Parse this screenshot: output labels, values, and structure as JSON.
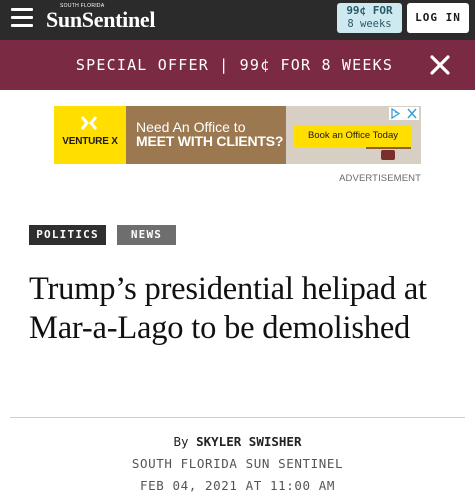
{
  "header": {
    "logo_small": "SOUTH FLORIDA",
    "logo": "SunSentinel",
    "offer_line1": "99¢ FOR",
    "offer_line2": "8 weeks",
    "login_label": "LOG IN"
  },
  "promo": {
    "text": "SPECIAL OFFER | 99¢ FOR 8 WEEKS"
  },
  "ad": {
    "brand": "VENTURE X",
    "headline_line1": "Need An Office to",
    "headline_line2": "MEET WITH CLIENTS?",
    "cta": "Book an Office Today",
    "label": "ADVERTISEMENT",
    "colors": {
      "brand_yellow": "#ffde00"
    }
  },
  "article": {
    "tags": [
      "POLITICS",
      "NEWS"
    ],
    "headline": "Trump’s presidential helipad at Mar-a-Lago to be demolished",
    "byline_prefix": "By",
    "author": "SKYLER SWISHER",
    "source": "SOUTH FLORIDA SUN SENTINEL",
    "date": "FEB 04, 2021 AT 11:00 AM"
  },
  "colors": {
    "header_bg": "#2b2b2b",
    "promo_bg": "#7b2a44",
    "offer_badge_bg": "#cfe9f1"
  }
}
